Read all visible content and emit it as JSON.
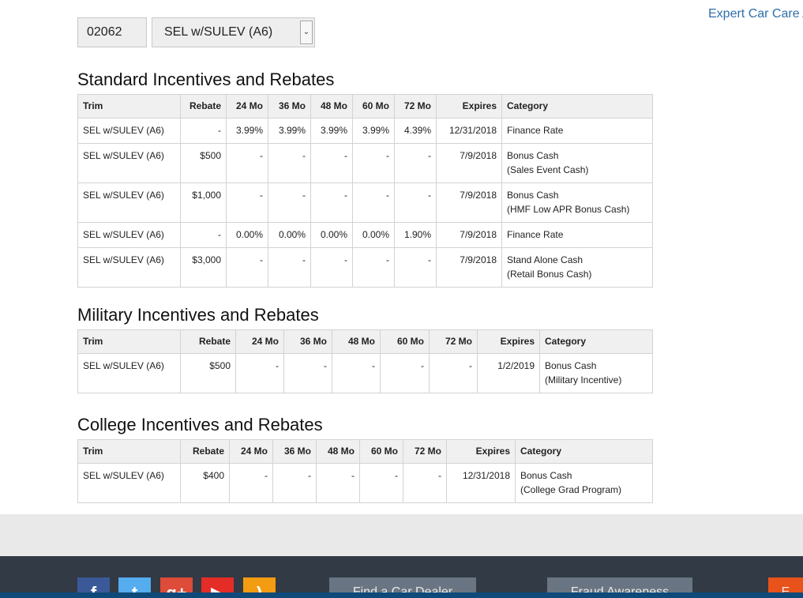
{
  "header": {
    "link_text": "Expert Car Care A"
  },
  "form": {
    "zip": "02062",
    "trim_selected": "SEL w/SULEV (A6)"
  },
  "standard": {
    "title": "Standard Incentives and Rebates",
    "columns": [
      "Trim",
      "Rebate",
      "24 Mo",
      "36 Mo",
      "48 Mo",
      "60 Mo",
      "72 Mo",
      "Expires",
      "Category"
    ],
    "rows": [
      {
        "trim": "SEL w/SULEV (A6)",
        "rebate": "-",
        "m24": "3.99%",
        "m36": "3.99%",
        "m48": "3.99%",
        "m60": "3.99%",
        "m72": "4.39%",
        "expires": "12/31/2018",
        "category": "Finance Rate",
        "sub": ""
      },
      {
        "trim": "SEL w/SULEV (A6)",
        "rebate": "$500",
        "m24": "-",
        "m36": "-",
        "m48": "-",
        "m60": "-",
        "m72": "-",
        "expires": "7/9/2018",
        "category": "Bonus Cash",
        "sub": "(Sales Event Cash)"
      },
      {
        "trim": "SEL w/SULEV (A6)",
        "rebate": "$1,000",
        "m24": "-",
        "m36": "-",
        "m48": "-",
        "m60": "-",
        "m72": "-",
        "expires": "7/9/2018",
        "category": "Bonus Cash",
        "sub": "(HMF Low APR Bonus Cash)"
      },
      {
        "trim": "SEL w/SULEV (A6)",
        "rebate": "-",
        "m24": "0.00%",
        "m36": "0.00%",
        "m48": "0.00%",
        "m60": "0.00%",
        "m72": "1.90%",
        "expires": "7/9/2018",
        "category": "Finance Rate",
        "sub": ""
      },
      {
        "trim": "SEL w/SULEV (A6)",
        "rebate": "$3,000",
        "m24": "-",
        "m36": "-",
        "m48": "-",
        "m60": "-",
        "m72": "-",
        "expires": "7/9/2018",
        "category": "Stand Alone Cash",
        "sub": "(Retail Bonus Cash)"
      }
    ]
  },
  "military": {
    "title": "Military Incentives and Rebates",
    "columns": [
      "Trim",
      "Rebate",
      "24 Mo",
      "36 Mo",
      "48 Mo",
      "60 Mo",
      "72 Mo",
      "Expires",
      "Category"
    ],
    "rows": [
      {
        "trim": "SEL w/SULEV (A6)",
        "rebate": "$500",
        "m24": "-",
        "m36": "-",
        "m48": "-",
        "m60": "-",
        "m72": "-",
        "expires": "1/2/2019",
        "category": "Bonus Cash",
        "sub": "(Military Incentive)"
      }
    ]
  },
  "college": {
    "title": "College Incentives and Rebates",
    "columns": [
      "Trim",
      "Rebate",
      "24 Mo",
      "36 Mo",
      "48 Mo",
      "60 Mo",
      "72 Mo",
      "Expires",
      "Category"
    ],
    "rows": [
      {
        "trim": "SEL w/SULEV (A6)",
        "rebate": "$400",
        "m24": "-",
        "m36": "-",
        "m48": "-",
        "m60": "-",
        "m72": "-",
        "expires": "12/31/2018",
        "category": "Bonus Cash",
        "sub": "(College Grad Program)"
      }
    ]
  },
  "footer": {
    "social": [
      {
        "name": "facebook-icon",
        "glyph": "f",
        "color": "#3b5998"
      },
      {
        "name": "twitter-icon",
        "glyph": "t",
        "color": "#55acee"
      },
      {
        "name": "google-plus-icon",
        "glyph": "g+",
        "color": "#dd4b39"
      },
      {
        "name": "youtube-icon",
        "glyph": "▶",
        "color": "#e52d27"
      },
      {
        "name": "rss-icon",
        "glyph": ")",
        "color": "#f39c12"
      }
    ],
    "buttons": [
      "Find a Car Dealer",
      "Fraud Awareness",
      "E"
    ],
    "orange_button_color": "#e8521b"
  }
}
